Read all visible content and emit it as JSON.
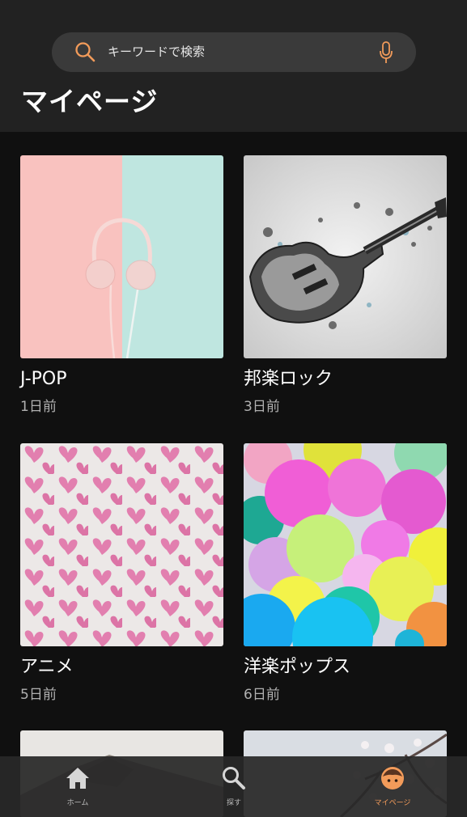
{
  "search": {
    "placeholder": "キーワードで検索",
    "search_icon": "search-icon",
    "mic_icon": "microphone-icon"
  },
  "page": {
    "title": "マイページ"
  },
  "cards": [
    {
      "title": "J-POP",
      "date": "1日前"
    },
    {
      "title": "邦楽ロック",
      "date": "3日前"
    },
    {
      "title": "アニメ",
      "date": "5日前"
    },
    {
      "title": "洋楽ポップス",
      "date": "6日前"
    }
  ],
  "tabs": [
    {
      "label": "ホーム",
      "icon": "home-icon",
      "active": false
    },
    {
      "label": "探す",
      "icon": "search-icon",
      "active": false
    },
    {
      "label": "マイページ",
      "icon": "user-face-icon",
      "active": true
    }
  ],
  "colors": {
    "accent": "#f29b5a",
    "background": "#101010",
    "header": "#222222"
  }
}
